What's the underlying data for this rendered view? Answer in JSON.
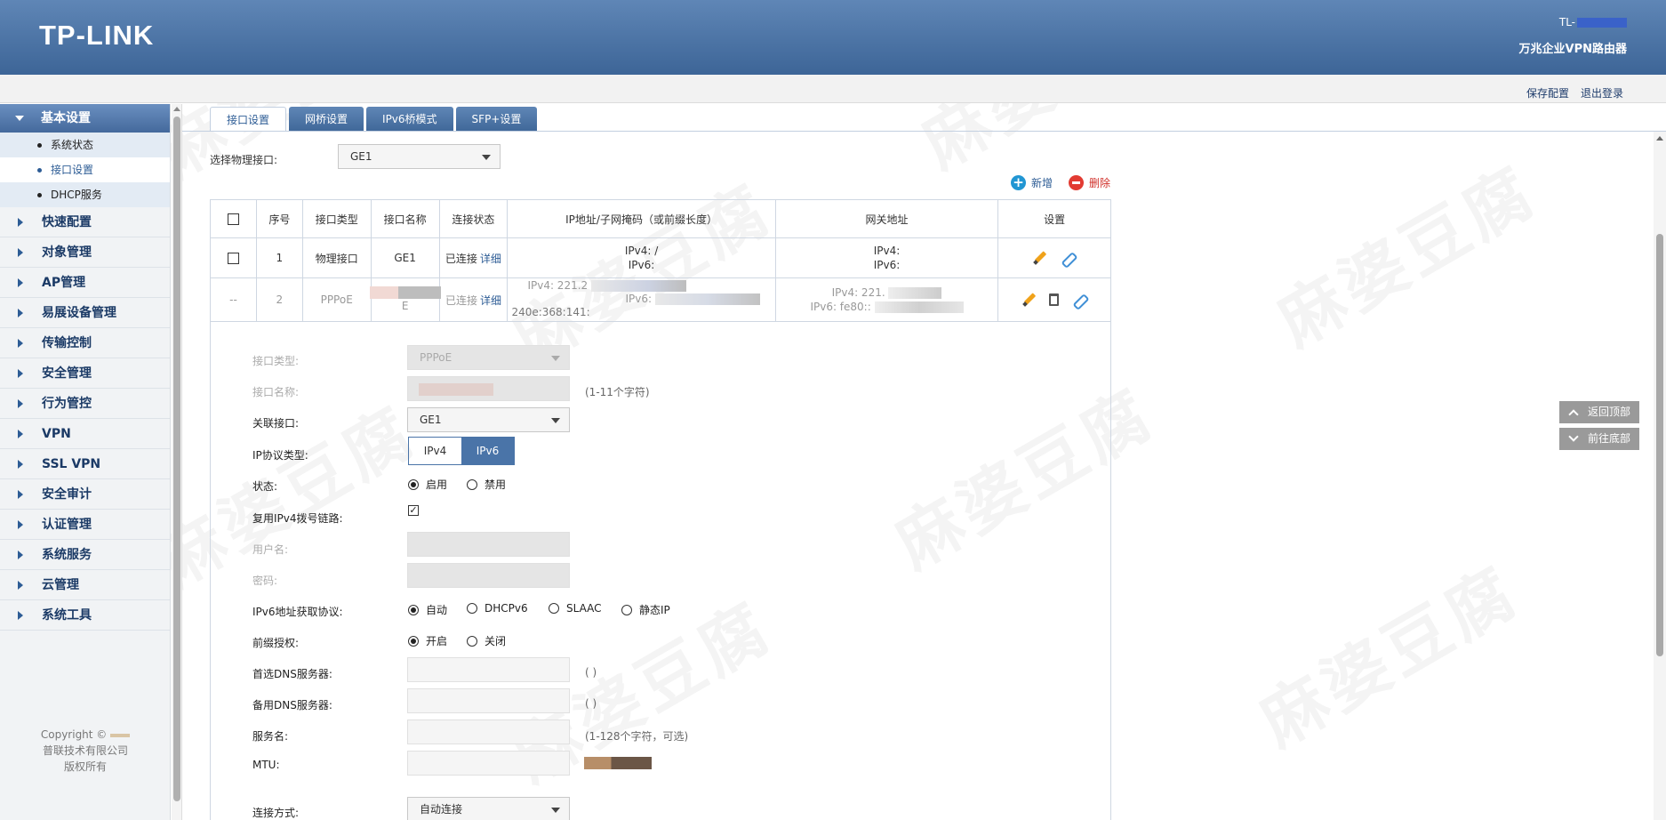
{
  "header": {
    "logo": "TP-LINK",
    "model_prefix": "TL-",
    "product": "万兆企业VPN路由器"
  },
  "topbar": {
    "save": "保存配置",
    "logout": "退出登录"
  },
  "sidebar": {
    "section": "基本设置",
    "sub_items": [
      "系统状态",
      "接口设置",
      "DHCP服务"
    ],
    "items": [
      "快速配置",
      "对象管理",
      "AP管理",
      "易展设备管理",
      "传输控制",
      "安全管理",
      "行为管控",
      "VPN",
      "SSL VPN",
      "安全审计",
      "认证管理",
      "系统服务",
      "云管理",
      "系统工具"
    ],
    "copyright_line1": "Copyright ©",
    "copyright_line2": "普联技术有限公司",
    "copyright_line3": "版权所有"
  },
  "tabs": [
    "接口设置",
    "网桥设置",
    "IPv6桥模式",
    "SFP+设置"
  ],
  "phys": {
    "label": "选择物理接口:",
    "value": "GE1"
  },
  "actions": {
    "add": "新增",
    "delete": "删除"
  },
  "table": {
    "headers": [
      "序号",
      "接口类型",
      "接口名称",
      "连接状态",
      "IP地址/子网掩码（或前缀长度）",
      "网关地址",
      "设置"
    ],
    "row1": {
      "no": "1",
      "type": "物理接口",
      "name": "GE1",
      "state": "已连接",
      "detail": "详细",
      "ip4": "IPv4:  /",
      "ip6": "IPv6:",
      "gw4": "IPv4:",
      "gw6": "IPv6:"
    },
    "row2": {
      "chk": "--",
      "no": "2",
      "type": "PPPoE",
      "name_suffix": "E",
      "state": "已连接",
      "detail": "详细",
      "ip4": "IPv4:  221.2",
      "ip6": "IPv6:",
      "ip6b": "240e:368:141:",
      "gw4": "IPv4:  221.",
      "gw6": "IPv6:  fe80::"
    }
  },
  "form": {
    "iface_type_label": "接口类型:",
    "iface_type_value": "PPPoE",
    "iface_name_label": "接口名称:",
    "iface_name_hint": "(1-11个字符)",
    "assoc_label": "关联接口:",
    "assoc_value": "GE1",
    "proto_label": "IP协议类型:",
    "proto_opts": [
      "IPv4",
      "IPv6"
    ],
    "state_label": "状态:",
    "state_on": "启用",
    "state_off": "禁用",
    "reuse_label": "复用IPv4拨号链路:",
    "reuse_check": "✓",
    "user_label": "用户名:",
    "pass_label": "密码:",
    "v6proto_label": "IPv6地址获取协议:",
    "v6proto_opts": [
      "自动",
      "DHCPv6",
      "SLAAC",
      "静态IP"
    ],
    "prefix_label": "前缀授权:",
    "prefix_on": "开启",
    "prefix_off": "关闭",
    "dns1_label": "首选DNS服务器:",
    "dns2_label": "备用DNS服务器:",
    "paren": "(      )",
    "svc_label": "服务名:",
    "svc_hint": "(1-128个字符，可选)",
    "mtu_label": "MTU:",
    "conn_label": "连接方式:",
    "conn_value": "自动连接"
  },
  "float": {
    "top": "返回顶部",
    "bottom": "前往底部"
  },
  "watermark": "麻婆豆腐"
}
